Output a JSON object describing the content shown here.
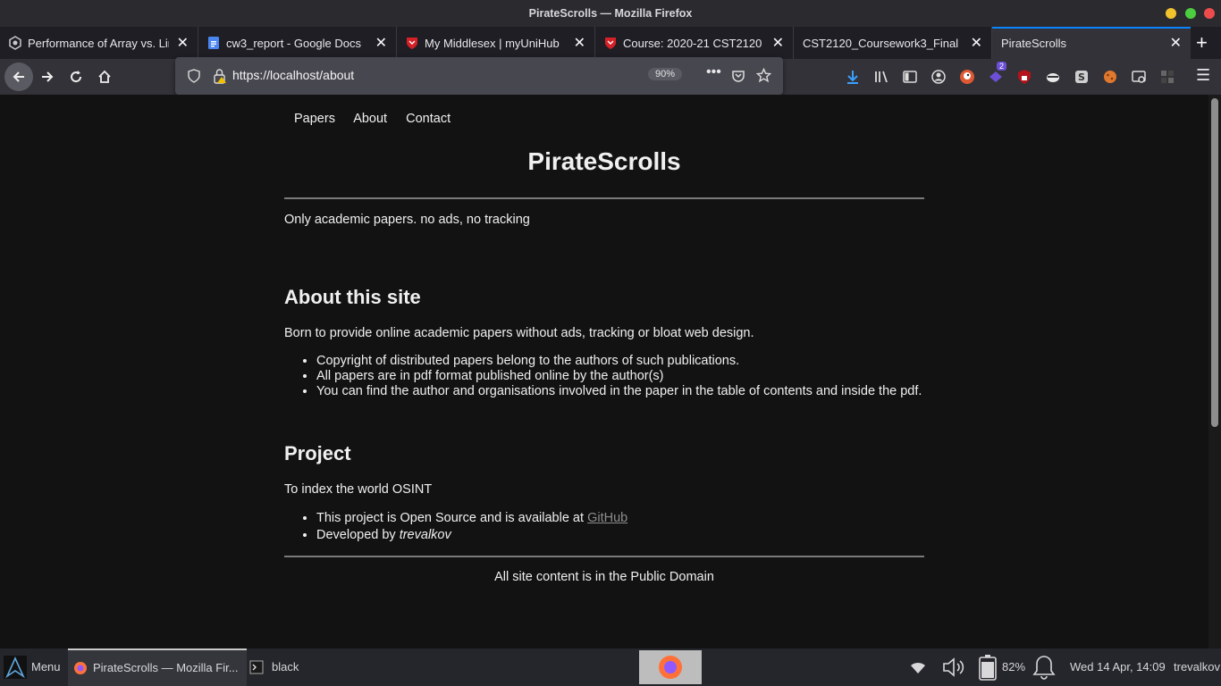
{
  "window": {
    "title": "PirateScrolls — Mozilla Firefox"
  },
  "tabs": [
    {
      "label": "Performance of Array vs. Lin"
    },
    {
      "label": "cw3_report - Google Docs"
    },
    {
      "label": "My Middlesex | myUniHub"
    },
    {
      "label": "Course: 2020-21 CST2120"
    },
    {
      "label": "CST2120_Coursework3_Final"
    },
    {
      "label": "PirateScrolls"
    }
  ],
  "navbar": {
    "url": "https://localhost/about",
    "zoom": "90%",
    "extensions_badge": "2"
  },
  "page": {
    "nav": [
      "Papers",
      "About",
      "Contact"
    ],
    "site_title": "PirateScrolls",
    "tagline": "Only academic papers. no ads, no tracking",
    "about": {
      "heading": "About this site",
      "intro": "Born to provide online academic papers without ads, tracking or bloat web design.",
      "items": [
        "Copyright of distributed papers belong to the authors of such publications.",
        "All papers are in pdf format published online by the author(s)",
        "You can find the author and organisations involved in the paper in the table of contents and inside the pdf."
      ]
    },
    "project": {
      "heading": "Project",
      "intro": "To index the world OSINT",
      "item1_text": "This project is Open Source and is available at ",
      "item1_link": "GitHub",
      "item2_text": "Developed by ",
      "item2_name": "trevalkov"
    },
    "footer": "All site content is in the Public Domain"
  },
  "taskbar": {
    "menu_label": "Menu",
    "window_item": "PirateScrolls — Mozilla Fir...",
    "terminal_item": "black",
    "battery": "82%",
    "clock": "Wed 14 Apr, 14:09",
    "user": "trevalkov"
  }
}
